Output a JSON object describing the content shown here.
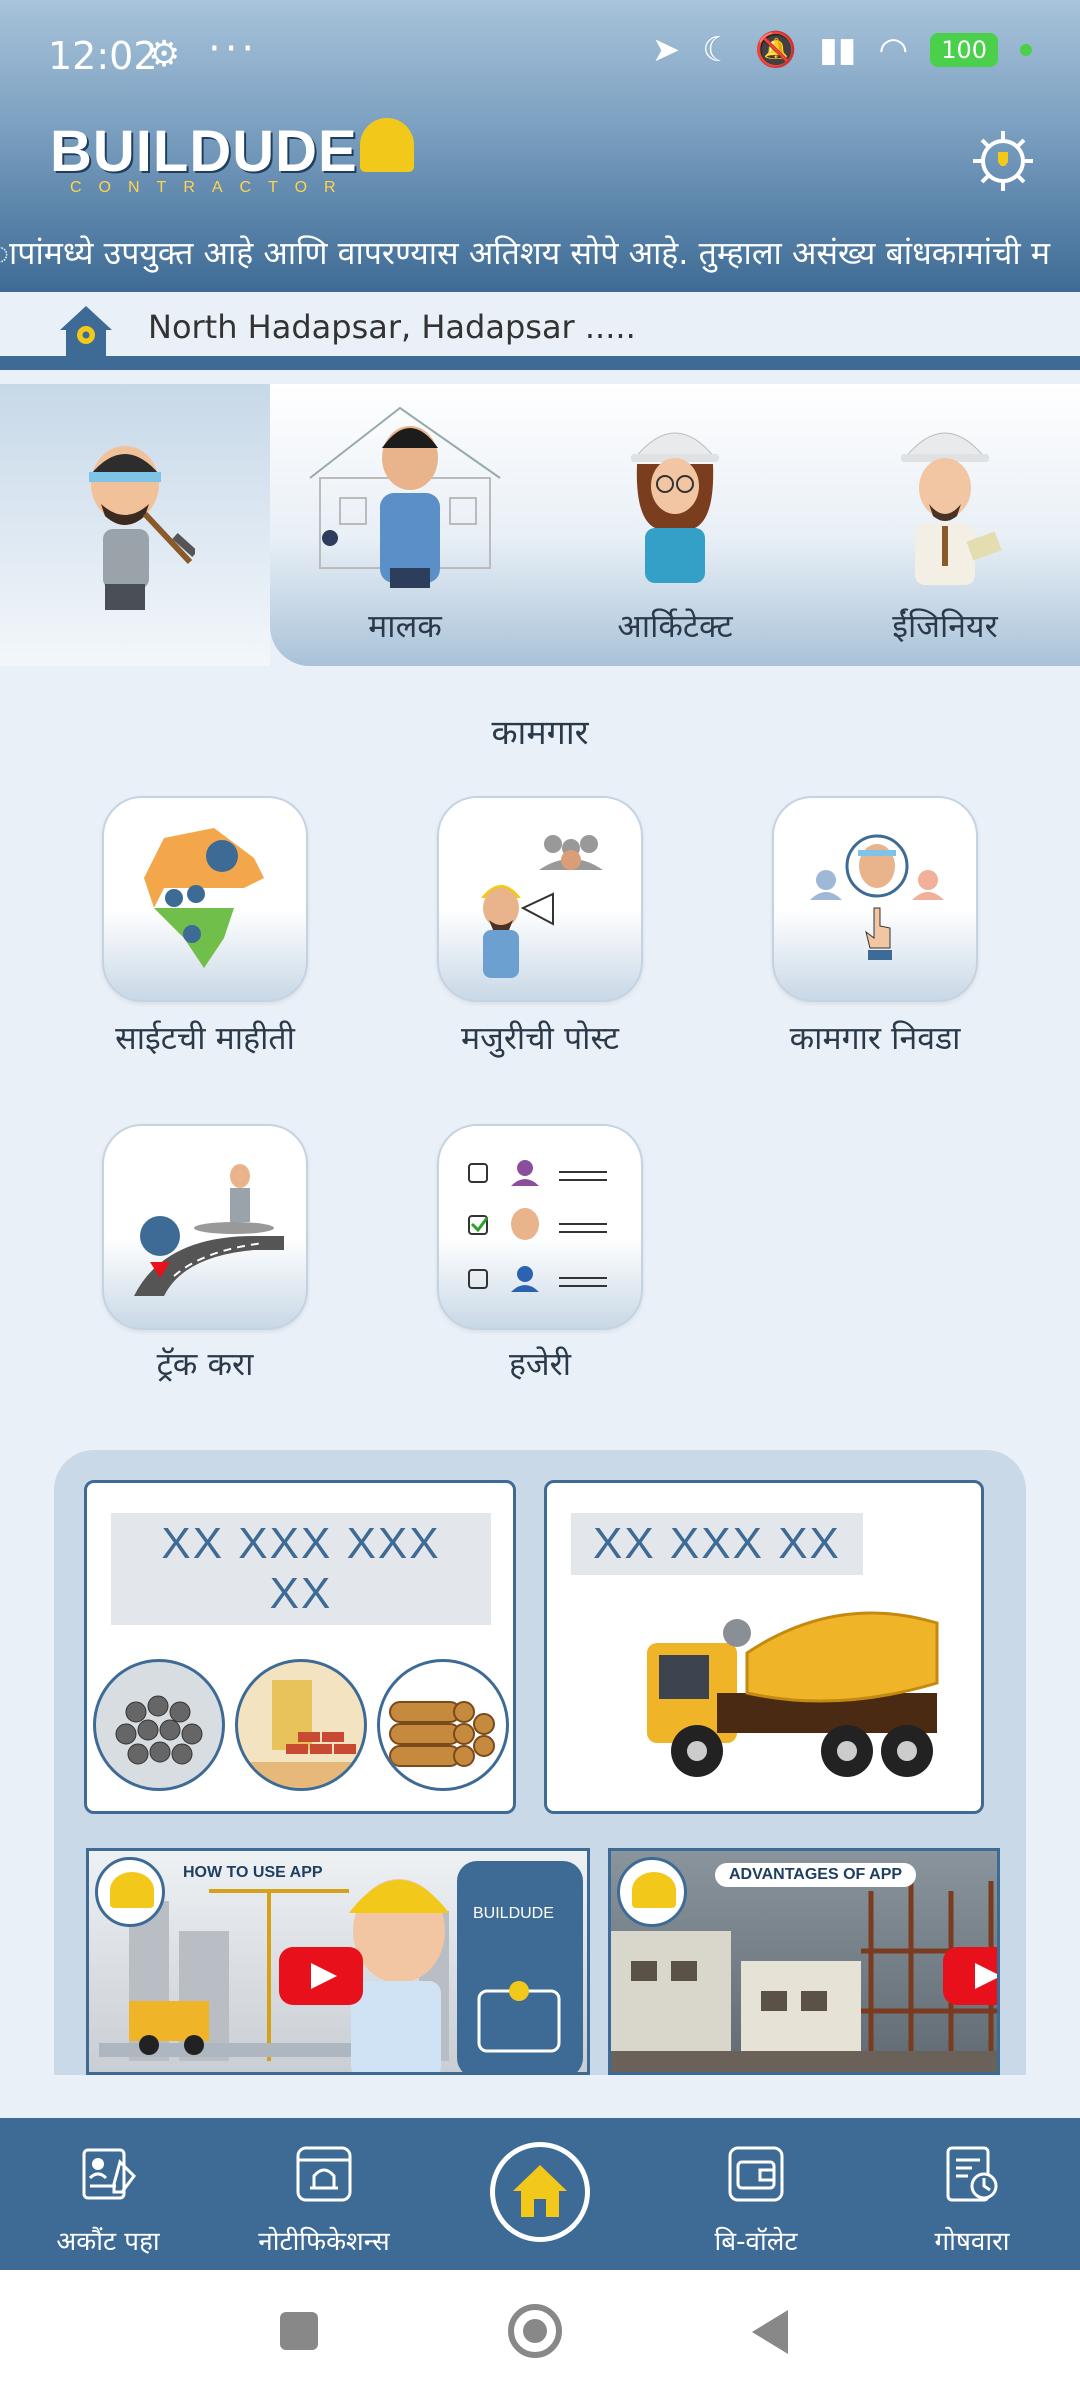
{
  "status_bar": {
    "time": "12:02",
    "battery": "100"
  },
  "brand": {
    "name": "BUILDUDE",
    "tagline": "CONTRACTOR"
  },
  "ticker_text": "ापांमध्ये उपयुक्त आहे आणि वापरण्यास अतिशय सोपे आहे.  तुम्हाला असंख्य बांधकामांची म",
  "location": {
    "text": "North Hadapsar, Hadapsar ....."
  },
  "roles": [
    {
      "label": "",
      "id": "worker"
    },
    {
      "label": "मालक",
      "id": "owner"
    },
    {
      "label": "आर्किटेक्ट",
      "id": "architect"
    },
    {
      "label": "ईंजिनियर",
      "id": "engineer"
    }
  ],
  "section_title": "कामगार",
  "tiles": [
    {
      "label": "साईटची माहीती",
      "icon": "india-map-icon"
    },
    {
      "label": "मजुरीची पोस्ट",
      "icon": "megaphone-icon"
    },
    {
      "label": "कामगार निवडा",
      "icon": "select-worker-icon"
    },
    {
      "label": "ट्रॅक करा",
      "icon": "road-track-icon"
    },
    {
      "label": "हजेरी",
      "icon": "attendance-checklist-icon"
    }
  ],
  "promo": {
    "card1_title": "XX XXX XXX XX",
    "card2_title": "XX XXX XX",
    "video1_label": "HOW TO USE APP",
    "video2_label": "ADVANTAGES OF APP",
    "video1_phone_brand": "BUILDUDE"
  },
  "bottom_nav": [
    {
      "label": "अकौंट पहा",
      "icon": "account-icon"
    },
    {
      "label": "नोटीफिकेशन्स",
      "icon": "notification-icon"
    },
    {
      "label": "",
      "icon": "home-icon"
    },
    {
      "label": "बि-वॉलेट",
      "icon": "wallet-icon"
    },
    {
      "label": "गोषवारा",
      "icon": "report-icon"
    }
  ],
  "colors": {
    "primary": "#3e6b95",
    "accent": "#f2c81a",
    "background": "#eaf0f7"
  }
}
